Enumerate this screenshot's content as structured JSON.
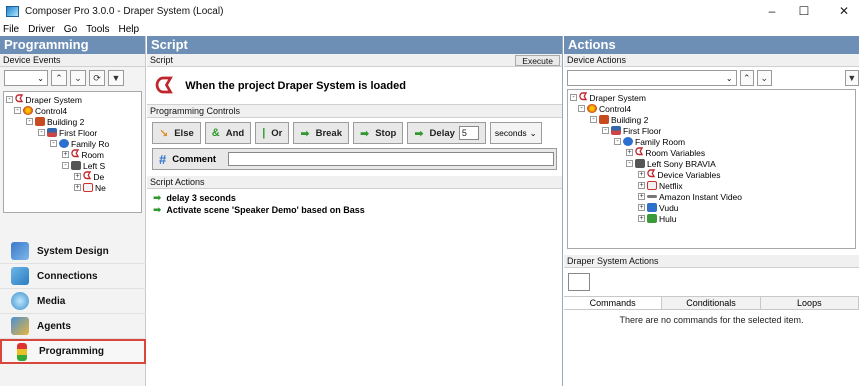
{
  "window": {
    "title": "Composer Pro 3.0.0 - Draper System (Local)",
    "controls": [
      "–",
      "☐",
      "✕"
    ]
  },
  "menu": [
    "File",
    "Driver",
    "Go",
    "Tools",
    "Help"
  ],
  "left": {
    "header": "Programming",
    "sub_header": "Device Events",
    "tree": [
      {
        "label": "Draper System",
        "icon": "c4-logo-icon",
        "expander": "-"
      },
      {
        "label": "Control4",
        "icon": "controller-icon",
        "expander": "-"
      },
      {
        "label": "Building 2",
        "icon": "building-icon",
        "expander": "-"
      },
      {
        "label": "First Floor",
        "icon": "floor-icon",
        "expander": "-"
      },
      {
        "label": "Family Ro",
        "icon": "room-icon",
        "expander": "-"
      },
      {
        "label": "Room",
        "icon": "c4-logo-icon",
        "expander": "+"
      },
      {
        "label": "Left S",
        "icon": "device-icon",
        "expander": "-"
      },
      {
        "label": "De",
        "icon": "c4-logo-icon",
        "expander": "+"
      },
      {
        "label": "Ne",
        "icon": "netflix-icon",
        "expander": "+"
      }
    ],
    "nav": [
      {
        "label": "System Design",
        "icon": "system-design-icon"
      },
      {
        "label": "Connections",
        "icon": "connections-icon"
      },
      {
        "label": "Media",
        "icon": "media-icon"
      },
      {
        "label": "Agents",
        "icon": "agents-icon"
      },
      {
        "label": "Programming",
        "icon": "programming-icon",
        "active": true
      }
    ]
  },
  "script": {
    "header": "Script",
    "sub_header": "Script",
    "execute_label": "Execute",
    "event_text": "When the project Draper System is loaded",
    "controls_header": "Programming Controls",
    "buttons": [
      {
        "label": "Else",
        "icon": "else-icon",
        "symbol": "↘"
      },
      {
        "label": "And",
        "icon": "and-icon",
        "symbol": "&"
      },
      {
        "label": "Or",
        "icon": "or-icon",
        "symbol": "|"
      },
      {
        "label": "Break",
        "icon": "break-arrow-icon",
        "symbol": "➡"
      },
      {
        "label": "Stop",
        "icon": "stop-arrow-icon",
        "symbol": "➡"
      }
    ],
    "delay": {
      "label": "Delay",
      "value": "5",
      "unit": "seconds"
    },
    "comment_label": "Comment",
    "actions_header": "Script Actions",
    "actions": [
      "delay 3 seconds",
      "Activate scene 'Speaker Demo' based on Bass"
    ]
  },
  "actions_panel": {
    "header": "Actions",
    "sub_header": "Device Actions",
    "tree": [
      {
        "label": "Draper System",
        "icon": "c4-logo-icon",
        "expander": "-"
      },
      {
        "label": "Control4",
        "icon": "controller-icon",
        "expander": "-"
      },
      {
        "label": "Building 2",
        "icon": "building-icon",
        "expander": "-"
      },
      {
        "label": "First Floor",
        "icon": "floor-icon",
        "expander": "-"
      },
      {
        "label": "Family Room",
        "icon": "room-icon",
        "expander": "-"
      },
      {
        "label": "Room Variables",
        "icon": "c4-logo-icon",
        "expander": "+"
      },
      {
        "label": "Left Sony BRAVIA",
        "icon": "device-icon",
        "expander": "-"
      },
      {
        "label": "Device Variables",
        "icon": "c4-logo-icon",
        "expander": "+"
      },
      {
        "label": "Netflix",
        "icon": "netflix-icon",
        "expander": "+"
      },
      {
        "label": "Amazon Instant Video",
        "icon": "amazon-icon",
        "expander": "+"
      },
      {
        "label": "Vudu",
        "icon": "vudu-icon",
        "expander": "+"
      },
      {
        "label": "Hulu",
        "icon": "hulu-icon",
        "expander": "+"
      }
    ],
    "system_actions_header": "Draper System Actions",
    "tabs": [
      "Commands",
      "Conditionals",
      "Loops"
    ],
    "empty_message": "There are no commands for the selected item."
  }
}
